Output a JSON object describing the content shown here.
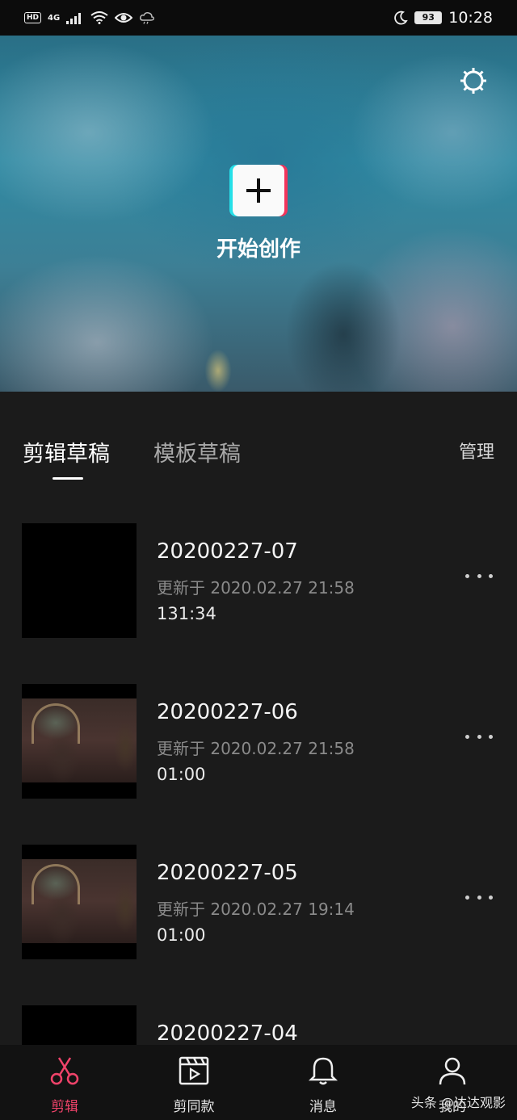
{
  "status_bar": {
    "hd": "HD",
    "network": "4G",
    "battery": "93",
    "time": "10:28"
  },
  "hero": {
    "create_label": "开始创作",
    "settings_icon": "settings-icon",
    "create_icon": "plus-icon"
  },
  "tabs": {
    "items": [
      {
        "label": "剪辑草稿",
        "active": true
      },
      {
        "label": "模板草稿",
        "active": false
      }
    ],
    "manage_label": "管理"
  },
  "drafts": [
    {
      "title": "20200227-07",
      "updated": "更新于 2020.02.27 21:58",
      "duration": "131:34",
      "thumb": "black"
    },
    {
      "title": "20200227-06",
      "updated": "更新于 2020.02.27 21:58",
      "duration": "01:00",
      "thumb": "scene"
    },
    {
      "title": "20200227-05",
      "updated": "更新于 2020.02.27 19:14",
      "duration": "01:00",
      "thumb": "scene"
    },
    {
      "title": "20200227-04",
      "updated": "",
      "duration": "",
      "thumb": "black"
    }
  ],
  "bottom_nav": [
    {
      "label": "剪辑",
      "icon": "scissors-icon",
      "active": true
    },
    {
      "label": "剪同款",
      "icon": "clapperboard-icon",
      "active": false
    },
    {
      "label": "消息",
      "icon": "bell-icon",
      "active": false
    },
    {
      "label": "我的",
      "icon": "person-icon",
      "active": false
    }
  ],
  "watermark": "头条 @达达观影",
  "colors": {
    "accent": "#f0436a",
    "background": "#1b1b1b",
    "cyan": "#26e0e8",
    "red": "#f2345b"
  }
}
